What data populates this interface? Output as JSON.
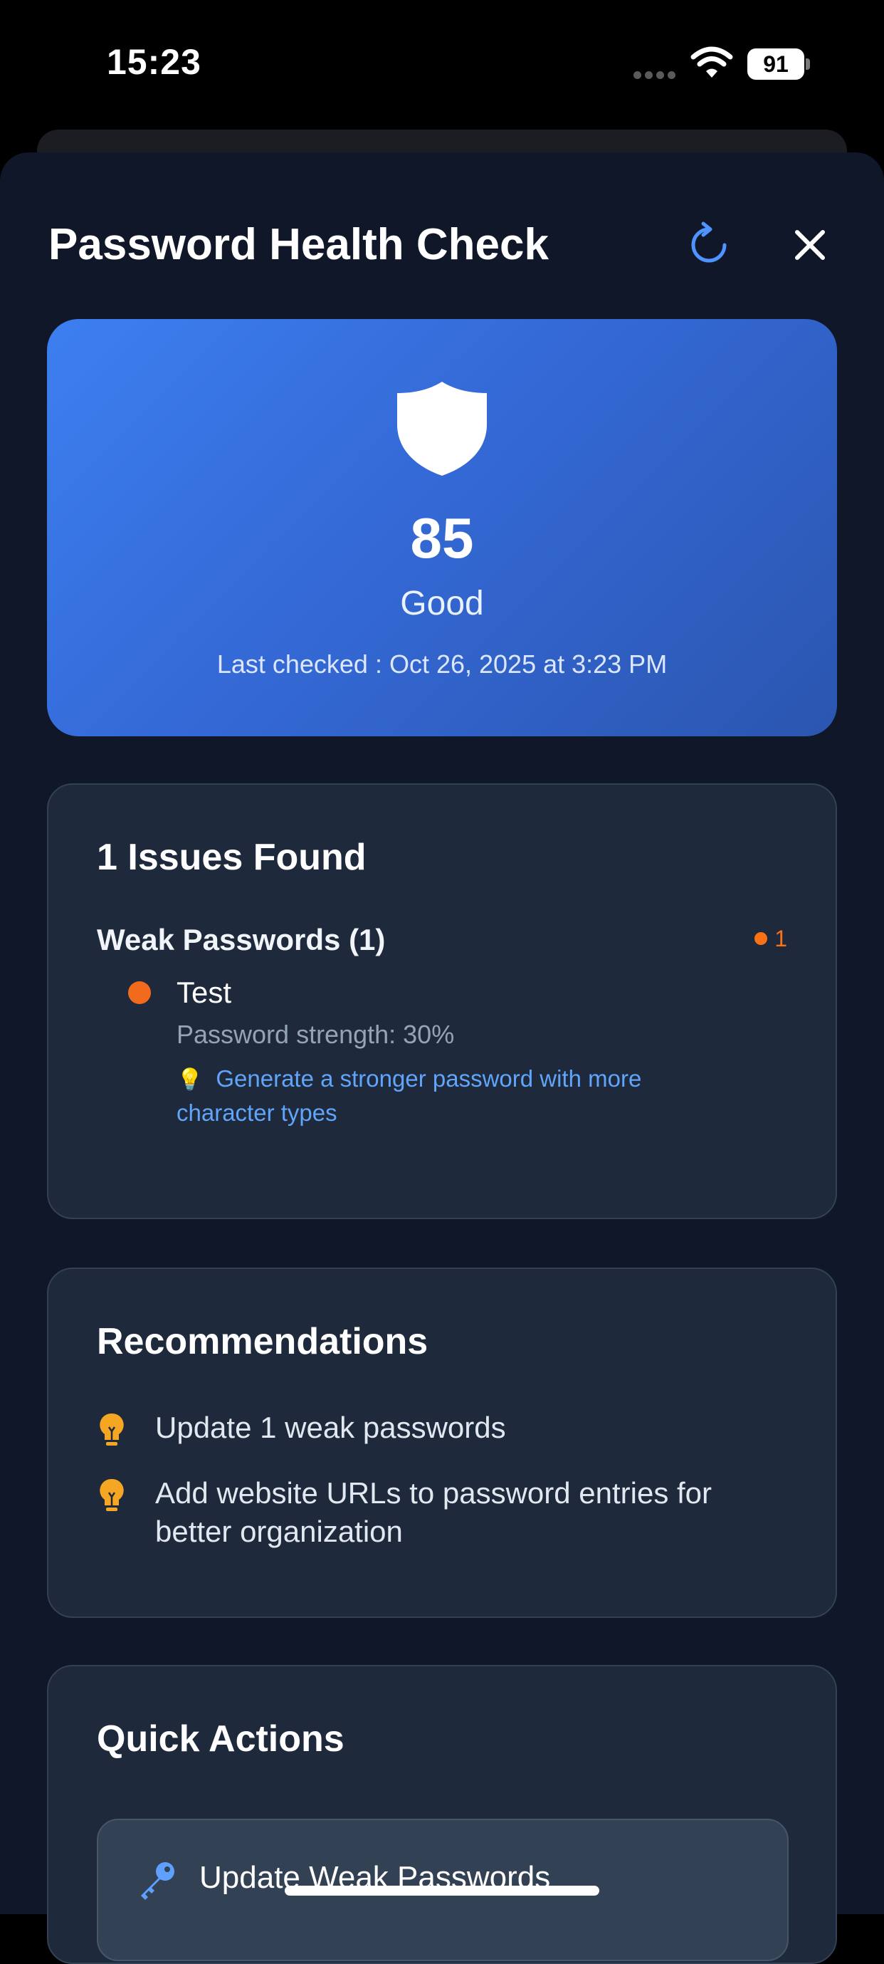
{
  "status_bar": {
    "time": "15:23",
    "battery": "91"
  },
  "sheet": {
    "title": "Password Health Check"
  },
  "score": {
    "value": "85",
    "label": "Good",
    "last_checked": "Last checked : Oct 26, 2025 at 3:23 PM"
  },
  "issues": {
    "title": "1 Issues Found",
    "group_label": "Weak Passwords (1)",
    "group_count": "1",
    "item": {
      "name": "Test",
      "strength": "Password strength: 30%",
      "tip_icon": "💡",
      "tip": "Generate a stronger password with more character types"
    }
  },
  "recommendations": {
    "title": "Recommendations",
    "items": [
      "Update 1 weak passwords",
      "Add website URLs to password entries for better organization"
    ]
  },
  "quick_actions": {
    "title": "Quick Actions",
    "update_weak_label": "Update Weak Passwords"
  },
  "colors": {
    "accent": "#3b82f6",
    "warning": "#f97316",
    "bulb": "#f5a623",
    "sheet_bg": "#0f1728",
    "card_bg": "#1e293b"
  },
  "icons": [
    "wifi-icon",
    "battery-icon",
    "refresh-icon",
    "close-icon",
    "shield-icon",
    "lightbulb-icon",
    "key-icon"
  ]
}
